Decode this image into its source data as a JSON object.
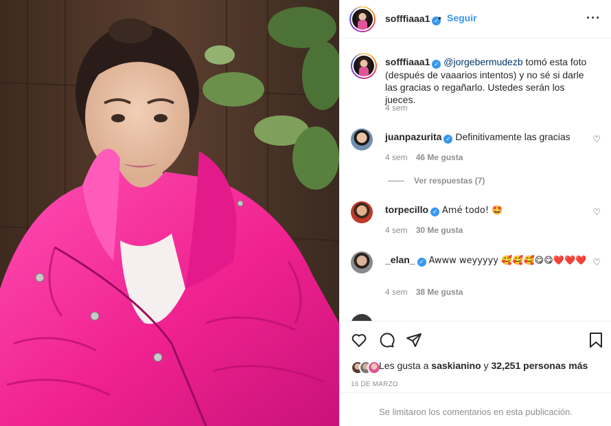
{
  "post": {
    "username": "sofffiaaa1",
    "separator": "•",
    "follow_label": "Seguir",
    "more_icon": "more-options-icon"
  },
  "caption": {
    "username": "sofffiaaa1",
    "mention": "@jorgebermudezb",
    "text": " tomó esta foto (después de vaaarios intentos) y no sé si darle las gracias o regañarlo. Ustedes serán los jueces.",
    "time": "4 sem"
  },
  "comments": [
    {
      "username": "juanpazurita",
      "text": "Definitivamente las gracias",
      "time": "4 sem",
      "likes": "46 Me gusta"
    },
    {
      "username": "torpecillo",
      "text": "Amé todo! 🤩",
      "time": "4 sem",
      "likes": "30 Me gusta"
    },
    {
      "username": "_elan_",
      "text": "Awww weyyyyy 🥰🥰🥰😋😋❤️❤️❤️",
      "time": "4 sem",
      "likes": "38 Me gusta"
    }
  ],
  "view_replies": "Ver respuestas (7)",
  "likes": {
    "prefix": "Les gusta a ",
    "user": "saskianino",
    "middle": " y ",
    "count": "32,251 personas más"
  },
  "date": "16 DE MARZO",
  "comments_limited": "Se limitaron los comentarios en esta publicación.",
  "colors": {
    "accent": "#3897f0",
    "jacket": "#ff2fa0",
    "muted": "#8e8e8e"
  }
}
